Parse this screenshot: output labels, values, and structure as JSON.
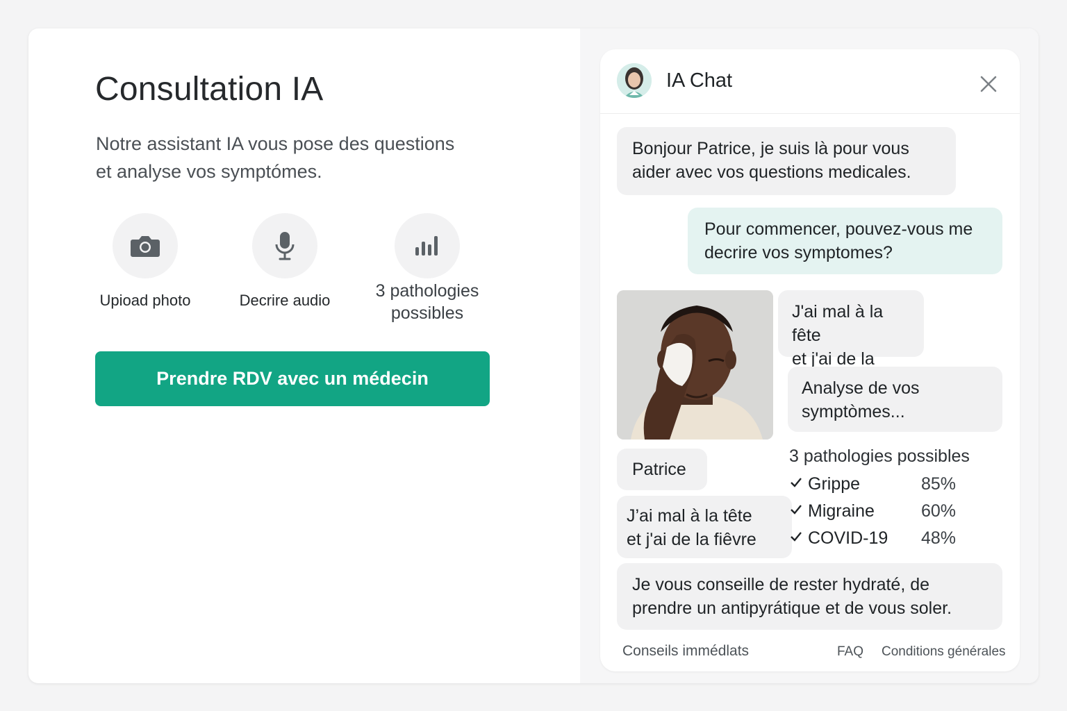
{
  "colors": {
    "accent": "#12a584",
    "user_bubble": "#e4f3f1",
    "ai_bubble": "#f1f1f2"
  },
  "left": {
    "title": "Consultation IA",
    "subtitle_line1": "Notre assistant IA vous pose des questions",
    "subtitle_line2": "et analyse vos symptómes.",
    "features": [
      {
        "icon": "camera-icon",
        "label": "Upioad photo"
      },
      {
        "icon": "microphone-icon",
        "label": "Decrire audio"
      },
      {
        "icon": "bar-chart-icon",
        "label_line1": "3 pathologies",
        "label_line2": "possibles"
      }
    ],
    "cta_label": "Prendre RDV avec un médecin"
  },
  "chat": {
    "title": "IA Chat",
    "messages": {
      "greeting_line1": "Bonjour Patrice, je suis là pour vous",
      "greeting_line2": "aider avec vos questions medicales.",
      "question_line1": "Pour commencer, pouvez-vous me",
      "question_line2": "decrire vos symptomes?",
      "reply1_line1": "J'ai mal à la fête",
      "reply1_line2": "et j'ai de la fiére",
      "analysis_line1": "Analyse de vos",
      "analysis_line2": "symptòmes...",
      "user_name": "Patrice",
      "reply2_line1": "J’ai mal à la tête",
      "reply2_line2": "et j'ai de la fiêvre",
      "advice_line1": "Je vous conseille de rester hydraté, de",
      "advice_line2": "prendre un antipyrátique et de vous soler."
    },
    "pathologies_title": "3 pathologies possibles",
    "pathologies": [
      {
        "name": "Grippe",
        "pct": "85%"
      },
      {
        "name": "Migraine",
        "pct": "60%"
      },
      {
        "name": "COVID-19",
        "pct": "48%"
      }
    ],
    "footer": {
      "link1": "Conseils immédlats",
      "link2": "FAQ",
      "link3": "Conditions générales"
    }
  }
}
